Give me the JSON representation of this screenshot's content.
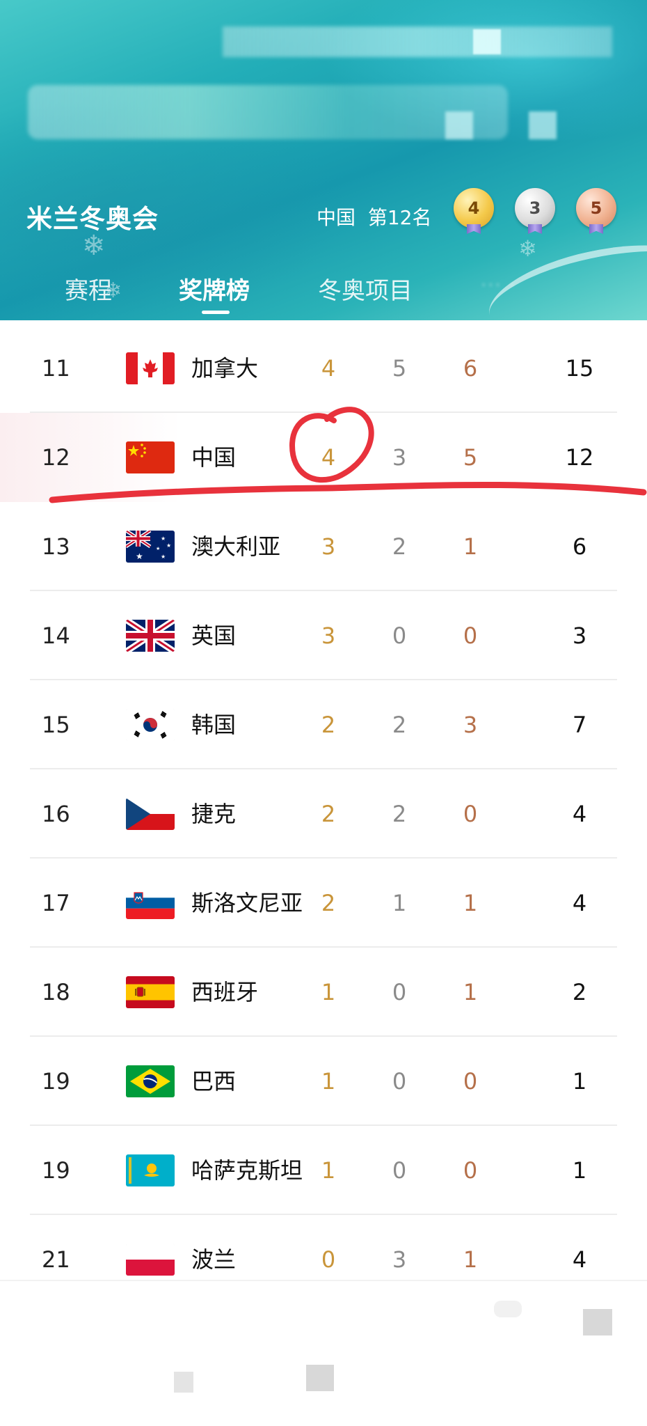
{
  "header": {
    "app_title": "米兰冬奥会",
    "country": "中国",
    "rank_label": "第12名",
    "medals": {
      "gold": "4",
      "silver": "3",
      "bronze": "5"
    }
  },
  "tabs": [
    {
      "label": "赛程",
      "active": false
    },
    {
      "label": "奖牌榜",
      "active": true
    },
    {
      "label": "冬奥项目",
      "active": false
    }
  ],
  "rows": [
    {
      "rank": "11",
      "country": "加拿大",
      "gold": "4",
      "silver": "5",
      "bronze": "6",
      "total": "15",
      "flag": "canada-flag-icon"
    },
    {
      "rank": "12",
      "country": "中国",
      "gold": "4",
      "silver": "3",
      "bronze": "5",
      "total": "12",
      "flag": "china-flag-icon"
    },
    {
      "rank": "13",
      "country": "澳大利亚",
      "gold": "3",
      "silver": "2",
      "bronze": "1",
      "total": "6",
      "flag": "australia-flag-icon"
    },
    {
      "rank": "14",
      "country": "英国",
      "gold": "3",
      "silver": "0",
      "bronze": "0",
      "total": "3",
      "flag": "uk-flag-icon"
    },
    {
      "rank": "15",
      "country": "韩国",
      "gold": "2",
      "silver": "2",
      "bronze": "3",
      "total": "7",
      "flag": "korea-flag-icon"
    },
    {
      "rank": "16",
      "country": "捷克",
      "gold": "2",
      "silver": "2",
      "bronze": "0",
      "total": "4",
      "flag": "czech-flag-icon"
    },
    {
      "rank": "17",
      "country": "斯洛文尼亚",
      "gold": "2",
      "silver": "1",
      "bronze": "1",
      "total": "4",
      "flag": "slovenia-flag-icon"
    },
    {
      "rank": "18",
      "country": "西班牙",
      "gold": "1",
      "silver": "0",
      "bronze": "1",
      "total": "2",
      "flag": "spain-flag-icon"
    },
    {
      "rank": "19",
      "country": "巴西",
      "gold": "1",
      "silver": "0",
      "bronze": "0",
      "total": "1",
      "flag": "brazil-flag-icon"
    },
    {
      "rank": "19",
      "country": "哈萨克斯坦",
      "gold": "1",
      "silver": "0",
      "bronze": "0",
      "total": "1",
      "flag": "kazakhstan-flag-icon"
    },
    {
      "rank": "21",
      "country": "波兰",
      "gold": "0",
      "silver": "3",
      "bronze": "1",
      "total": "4",
      "flag": "poland-flag-icon"
    }
  ],
  "colors": {
    "gold": "#c9953a",
    "silver": "#8a8a8a",
    "bronze": "#b5704a",
    "annotation": "#e8323c",
    "header_teal": "#1698ad"
  }
}
